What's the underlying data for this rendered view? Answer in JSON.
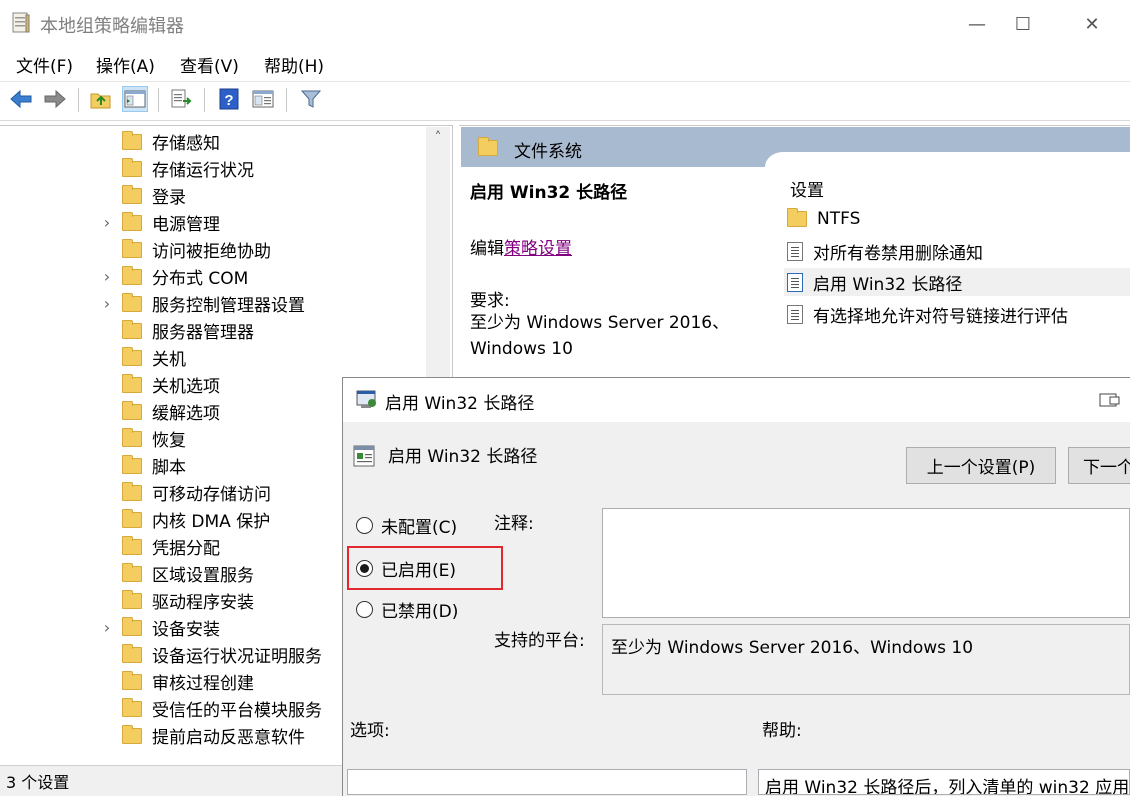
{
  "window": {
    "title": "本地组策略编辑器",
    "controls": {
      "minimize": "—",
      "maximize": "☐",
      "close": "✕"
    }
  },
  "menu": [
    "文件(F)",
    "操作(A)",
    "查看(V)",
    "帮助(H)"
  ],
  "toolbar": [
    "back-arrow-icon",
    "forward-arrow-icon",
    "up-folder-icon",
    "show-tree-icon",
    "export-list-icon",
    "help-icon",
    "properties-icon",
    "filter-icon"
  ],
  "tree": {
    "items": [
      {
        "label": "存储感知",
        "expandable": false
      },
      {
        "label": "存储运行状况",
        "expandable": false
      },
      {
        "label": "登录",
        "expandable": false
      },
      {
        "label": "电源管理",
        "expandable": true
      },
      {
        "label": "访问被拒绝协助",
        "expandable": false
      },
      {
        "label": "分布式 COM",
        "expandable": true
      },
      {
        "label": "服务控制管理器设置",
        "expandable": true
      },
      {
        "label": "服务器管理器",
        "expandable": false
      },
      {
        "label": "关机",
        "expandable": false
      },
      {
        "label": "关机选项",
        "expandable": false
      },
      {
        "label": "缓解选项",
        "expandable": false
      },
      {
        "label": "恢复",
        "expandable": false
      },
      {
        "label": "脚本",
        "expandable": false
      },
      {
        "label": "可移动存储访问",
        "expandable": false
      },
      {
        "label": "内核 DMA 保护",
        "expandable": false
      },
      {
        "label": "凭据分配",
        "expandable": false
      },
      {
        "label": "区域设置服务",
        "expandable": false
      },
      {
        "label": "驱动程序安装",
        "expandable": false
      },
      {
        "label": "设备安装",
        "expandable": true
      },
      {
        "label": "设备运行状况证明服务",
        "expandable": false
      },
      {
        "label": "审核过程创建",
        "expandable": false
      },
      {
        "label": "受信任的平台模块服务",
        "expandable": false
      },
      {
        "label": "提前启动反恶意软件",
        "expandable": false
      }
    ],
    "expander_glyph": "›",
    "scroll_up": "˄"
  },
  "right_pane": {
    "header": "文件系统",
    "policy_title": "启用 Win32 长路径",
    "edit_prefix": "编辑",
    "edit_link": "策略设置",
    "requirement_label": "要求:",
    "requirement_text": "至少为 Windows Server 2016、Windows 10",
    "settings_header": "设置",
    "settings": [
      {
        "label": "NTFS",
        "icon": "folder-icon"
      },
      {
        "label": "对所有卷禁用删除通知",
        "icon": "policy-document-icon"
      },
      {
        "label": "启用 Win32 长路径",
        "icon": "policy-document-icon",
        "selected": true
      },
      {
        "label": "有选择地允许对符号链接进行评估",
        "icon": "policy-document-icon"
      }
    ]
  },
  "status": {
    "text": "3 个设置"
  },
  "dialog": {
    "title": "启用 Win32 长路径",
    "setting_name": "启用 Win32 长路径",
    "prev_button": "上一个设置(P)",
    "next_button": "下一个",
    "options": [
      {
        "label": "未配置(C)",
        "selected": false
      },
      {
        "label": "已启用(E)",
        "selected": true
      },
      {
        "label": "已禁用(D)",
        "selected": false
      }
    ],
    "comment_label": "注释:",
    "comment_value": "",
    "platform_label": "支持的平台:",
    "platform_value": "至少为 Windows Server 2016、Windows 10",
    "options_label": "选项:",
    "help_label": "帮助:",
    "help_text": "启用 Win32 长路径后，列入清单的 win32 应用"
  },
  "colors": {
    "highlight_border": "#e0282e",
    "header_bg": "#a8bad0",
    "link": "#800080",
    "selected_row": "#f0f0f0"
  }
}
